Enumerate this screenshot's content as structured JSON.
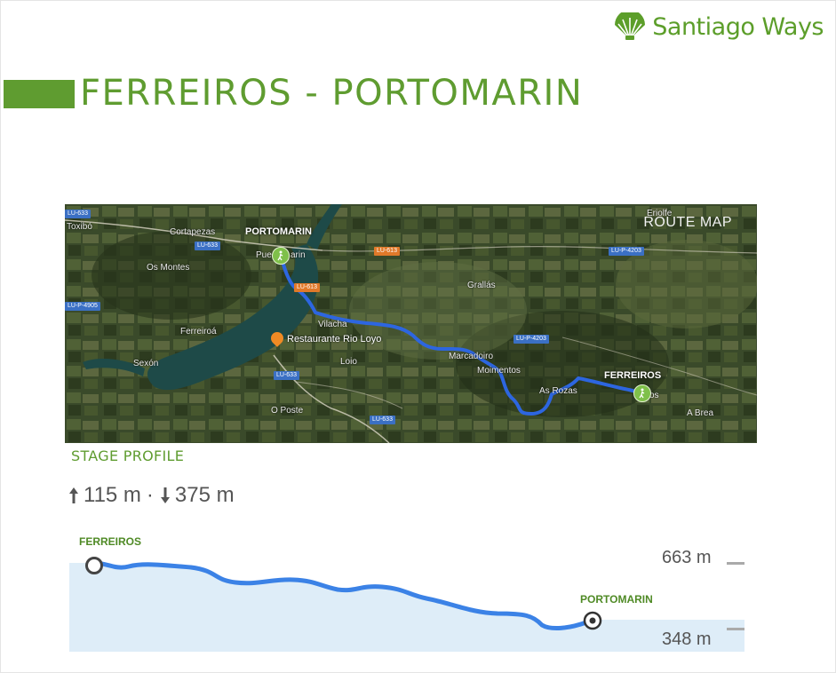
{
  "brand": {
    "name": "Santiago Ways"
  },
  "stage": {
    "title": "FERREIROS - PORTOMARIN"
  },
  "map": {
    "heading": "ROUTE MAP",
    "start": "FERREIROS",
    "end": "PORTOMARIN",
    "poi": "Restaurante Rio Loyo",
    "places": [
      "Toxibó",
      "Cortapezas",
      "Os Montes",
      "Ferreiroá",
      "Sexón",
      "Vilacha",
      "Loio",
      "O Poste",
      "Grallás",
      "Marcadoiro",
      "Moimentos",
      "As Rozas",
      "A Brea",
      "Eriolfe",
      "Pue",
      "arin",
      "os"
    ],
    "roads": [
      "LU-633",
      "LU-633",
      "LU-613",
      "LU-P-4905",
      "LU-P-4203",
      "LU-P-4203",
      "LU-633",
      "LU-633",
      "LU-613"
    ]
  },
  "profile": {
    "heading": "STAGE PROFILE",
    "ascent": "115 m",
    "descent": "375 m",
    "separator": "·",
    "max_label": "663 m",
    "min_label": "348 m",
    "start_label": "FERREIROS",
    "end_label": "PORTOMARIN",
    "colors": {
      "route": "#3b82e6",
      "fill": "#deedf8",
      "accent": "#5f9c30"
    }
  }
}
